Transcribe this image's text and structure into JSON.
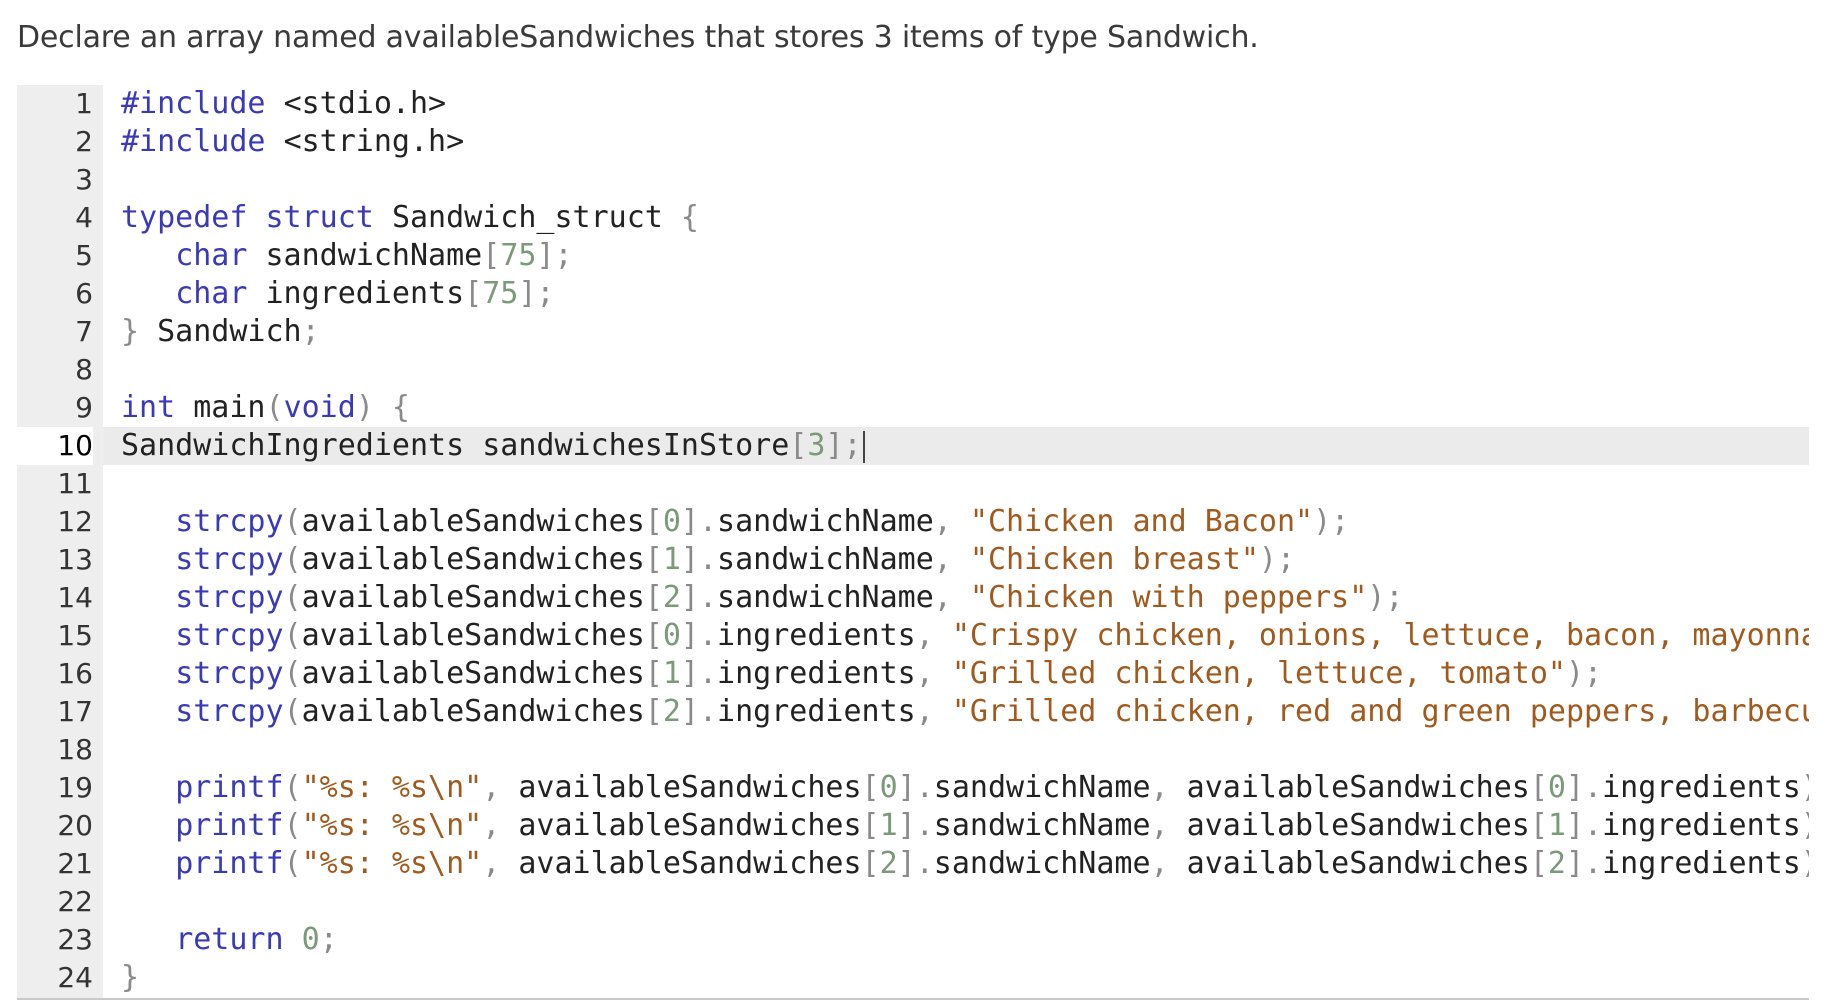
{
  "prompt": "Declare an array named availableSandwiches that stores 3 items of type Sandwich.",
  "editor": {
    "active_line": 10,
    "lines": [
      {
        "n": "1",
        "tokens": [
          [
            "kw",
            "#include "
          ],
          [
            "id",
            "<stdio.h>"
          ]
        ]
      },
      {
        "n": "2",
        "tokens": [
          [
            "kw",
            "#include "
          ],
          [
            "id",
            "<string.h>"
          ]
        ]
      },
      {
        "n": "3",
        "tokens": []
      },
      {
        "n": "4",
        "tokens": [
          [
            "kw",
            "typedef struct "
          ],
          [
            "id",
            "Sandwich_struct "
          ],
          [
            "pun",
            "{"
          ]
        ]
      },
      {
        "n": "5",
        "tokens": [
          [
            "id",
            "   "
          ],
          [
            "kw",
            "char "
          ],
          [
            "id",
            "sandwichName"
          ],
          [
            "pun",
            "["
          ],
          [
            "num",
            "75"
          ],
          [
            "pun",
            "];"
          ]
        ]
      },
      {
        "n": "6",
        "tokens": [
          [
            "id",
            "   "
          ],
          [
            "kw",
            "char "
          ],
          [
            "id",
            "ingredients"
          ],
          [
            "pun",
            "["
          ],
          [
            "num",
            "75"
          ],
          [
            "pun",
            "];"
          ]
        ]
      },
      {
        "n": "7",
        "tokens": [
          [
            "pun",
            "} "
          ],
          [
            "id",
            "Sandwich"
          ],
          [
            "pun",
            ";"
          ]
        ]
      },
      {
        "n": "8",
        "tokens": []
      },
      {
        "n": "9",
        "tokens": [
          [
            "kw",
            "int "
          ],
          [
            "id",
            "main"
          ],
          [
            "pun",
            "("
          ],
          [
            "kw",
            "void"
          ],
          [
            "pun",
            ") {"
          ]
        ]
      },
      {
        "n": "10",
        "tokens": [
          [
            "id",
            "SandwichIngredients sandwichesInStore"
          ],
          [
            "pun",
            "["
          ],
          [
            "num",
            "3"
          ],
          [
            "pun",
            "];"
          ]
        ]
      },
      {
        "n": "11",
        "tokens": []
      },
      {
        "n": "12",
        "tokens": [
          [
            "id",
            "   "
          ],
          [
            "kw",
            "strcpy"
          ],
          [
            "pun",
            "("
          ],
          [
            "id",
            "availableSandwiches"
          ],
          [
            "pun",
            "["
          ],
          [
            "num",
            "0"
          ],
          [
            "pun",
            "]."
          ],
          [
            "id",
            "sandwichName"
          ],
          [
            "pun",
            ", "
          ],
          [
            "str",
            "\"Chicken and Bacon\""
          ],
          [
            "pun",
            ");"
          ]
        ]
      },
      {
        "n": "13",
        "tokens": [
          [
            "id",
            "   "
          ],
          [
            "kw",
            "strcpy"
          ],
          [
            "pun",
            "("
          ],
          [
            "id",
            "availableSandwiches"
          ],
          [
            "pun",
            "["
          ],
          [
            "num",
            "1"
          ],
          [
            "pun",
            "]."
          ],
          [
            "id",
            "sandwichName"
          ],
          [
            "pun",
            ", "
          ],
          [
            "str",
            "\"Chicken breast\""
          ],
          [
            "pun",
            ");"
          ]
        ]
      },
      {
        "n": "14",
        "tokens": [
          [
            "id",
            "   "
          ],
          [
            "kw",
            "strcpy"
          ],
          [
            "pun",
            "("
          ],
          [
            "id",
            "availableSandwiches"
          ],
          [
            "pun",
            "["
          ],
          [
            "num",
            "2"
          ],
          [
            "pun",
            "]."
          ],
          [
            "id",
            "sandwichName"
          ],
          [
            "pun",
            ", "
          ],
          [
            "str",
            "\"Chicken with peppers\""
          ],
          [
            "pun",
            ");"
          ]
        ]
      },
      {
        "n": "15",
        "tokens": [
          [
            "id",
            "   "
          ],
          [
            "kw",
            "strcpy"
          ],
          [
            "pun",
            "("
          ],
          [
            "id",
            "availableSandwiches"
          ],
          [
            "pun",
            "["
          ],
          [
            "num",
            "0"
          ],
          [
            "pun",
            "]."
          ],
          [
            "id",
            "ingredients"
          ],
          [
            "pun",
            ", "
          ],
          [
            "str",
            "\"Crispy chicken, onions, lettuce, bacon, mayonnaise\""
          ],
          [
            "pun",
            ");"
          ]
        ]
      },
      {
        "n": "16",
        "tokens": [
          [
            "id",
            "   "
          ],
          [
            "kw",
            "strcpy"
          ],
          [
            "pun",
            "("
          ],
          [
            "id",
            "availableSandwiches"
          ],
          [
            "pun",
            "["
          ],
          [
            "num",
            "1"
          ],
          [
            "pun",
            "]."
          ],
          [
            "id",
            "ingredients"
          ],
          [
            "pun",
            ", "
          ],
          [
            "str",
            "\"Grilled chicken, lettuce, tomato\""
          ],
          [
            "pun",
            ");"
          ]
        ]
      },
      {
        "n": "17",
        "tokens": [
          [
            "id",
            "   "
          ],
          [
            "kw",
            "strcpy"
          ],
          [
            "pun",
            "("
          ],
          [
            "id",
            "availableSandwiches"
          ],
          [
            "pun",
            "["
          ],
          [
            "num",
            "2"
          ],
          [
            "pun",
            "]."
          ],
          [
            "id",
            "ingredients"
          ],
          [
            "pun",
            ", "
          ],
          [
            "str",
            "\"Grilled chicken, red and green peppers, barbecue sauce'"
          ]
        ]
      },
      {
        "n": "18",
        "tokens": []
      },
      {
        "n": "19",
        "tokens": [
          [
            "id",
            "   "
          ],
          [
            "kw",
            "printf"
          ],
          [
            "pun",
            "("
          ],
          [
            "str",
            "\"%s: %s\\n\""
          ],
          [
            "pun",
            ", "
          ],
          [
            "id",
            "availableSandwiches"
          ],
          [
            "pun",
            "["
          ],
          [
            "num",
            "0"
          ],
          [
            "pun",
            "]."
          ],
          [
            "id",
            "sandwichName"
          ],
          [
            "pun",
            ", "
          ],
          [
            "id",
            "availableSandwiches"
          ],
          [
            "pun",
            "["
          ],
          [
            "num",
            "0"
          ],
          [
            "pun",
            "]."
          ],
          [
            "id",
            "ingredients"
          ],
          [
            "pun",
            ");"
          ]
        ]
      },
      {
        "n": "20",
        "tokens": [
          [
            "id",
            "   "
          ],
          [
            "kw",
            "printf"
          ],
          [
            "pun",
            "("
          ],
          [
            "str",
            "\"%s: %s\\n\""
          ],
          [
            "pun",
            ", "
          ],
          [
            "id",
            "availableSandwiches"
          ],
          [
            "pun",
            "["
          ],
          [
            "num",
            "1"
          ],
          [
            "pun",
            "]."
          ],
          [
            "id",
            "sandwichName"
          ],
          [
            "pun",
            ", "
          ],
          [
            "id",
            "availableSandwiches"
          ],
          [
            "pun",
            "["
          ],
          [
            "num",
            "1"
          ],
          [
            "pun",
            "]."
          ],
          [
            "id",
            "ingredients"
          ],
          [
            "pun",
            ");"
          ]
        ]
      },
      {
        "n": "21",
        "tokens": [
          [
            "id",
            "   "
          ],
          [
            "kw",
            "printf"
          ],
          [
            "pun",
            "("
          ],
          [
            "str",
            "\"%s: %s\\n\""
          ],
          [
            "pun",
            ", "
          ],
          [
            "id",
            "availableSandwiches"
          ],
          [
            "pun",
            "["
          ],
          [
            "num",
            "2"
          ],
          [
            "pun",
            "]."
          ],
          [
            "id",
            "sandwichName"
          ],
          [
            "pun",
            ", "
          ],
          [
            "id",
            "availableSandwiches"
          ],
          [
            "pun",
            "["
          ],
          [
            "num",
            "2"
          ],
          [
            "pun",
            "]."
          ],
          [
            "id",
            "ingredients"
          ],
          [
            "pun",
            ");"
          ]
        ]
      },
      {
        "n": "22",
        "tokens": []
      },
      {
        "n": "23",
        "tokens": [
          [
            "id",
            "   "
          ],
          [
            "kw",
            "return "
          ],
          [
            "num",
            "0"
          ],
          [
            "pun",
            ";"
          ]
        ]
      },
      {
        "n": "24",
        "tokens": [
          [
            "pun",
            "}"
          ]
        ]
      }
    ]
  },
  "colors": {
    "keyword": "#3a3ab8",
    "string": "#a05a1e",
    "number": "#7a9a7a",
    "punctuation": "#8a8a8a",
    "gutter": "#eeeeee",
    "active_line": "#ebebeb"
  }
}
